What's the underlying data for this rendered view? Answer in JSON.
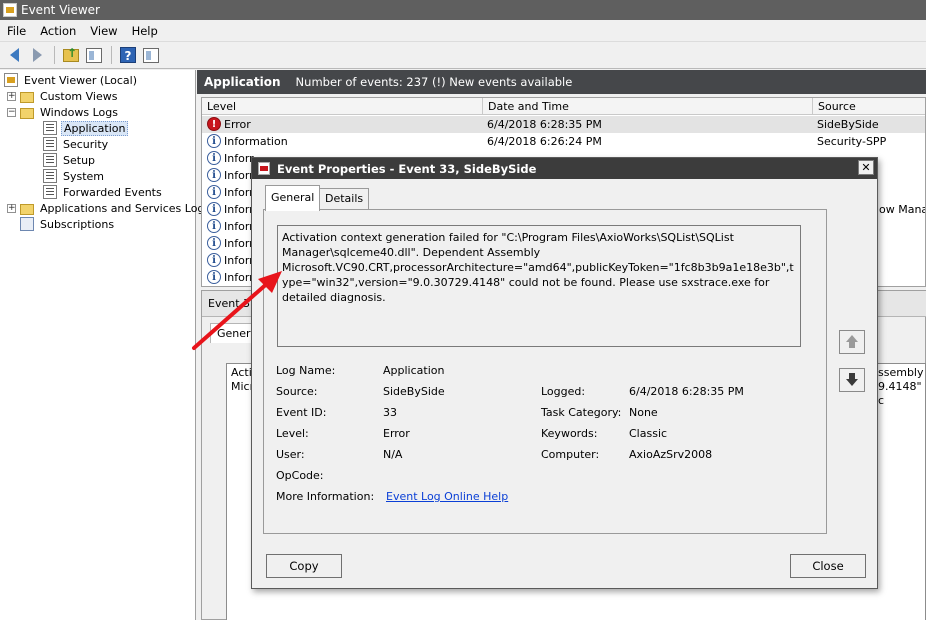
{
  "window": {
    "title": "Event Viewer"
  },
  "menu": [
    "File",
    "Action",
    "View",
    "Help"
  ],
  "toolbar": {
    "icons": [
      "back-arrow-icon",
      "forward-arrow-icon",
      "up-folder-icon",
      "show-hide-pane-icon",
      "help-icon",
      "pane-icon"
    ]
  },
  "tree": {
    "root": "Event Viewer (Local)",
    "custom_views": "Custom Views",
    "windows_logs": "Windows Logs",
    "logs": [
      "Application",
      "Security",
      "Setup",
      "System",
      "Forwarded Events"
    ],
    "apps_services": "Applications and Services Logs",
    "subscriptions": "Subscriptions"
  },
  "header": {
    "title": "Application",
    "summary": "Number of events: 237 (!) New events available"
  },
  "event_list": {
    "columns": [
      "Level",
      "Date and Time",
      "Source"
    ],
    "rows": [
      {
        "level": "Error",
        "datetime": "6/4/2018 6:28:35 PM",
        "source": "SideBySide"
      },
      {
        "level": "Information",
        "datetime": "6/4/2018 6:26:24 PM",
        "source": "Security-SPP"
      },
      {
        "level": "Inforr",
        "datetime": "",
        "source": ""
      },
      {
        "level": "Inforr",
        "datetime": "",
        "source": ""
      },
      {
        "level": "Inforr",
        "datetime": "",
        "source": ""
      },
      {
        "level": "Inforr",
        "datetime": "",
        "source": "ow Mana"
      },
      {
        "level": "Inforr",
        "datetime": "",
        "source": ""
      },
      {
        "level": "Inforr",
        "datetime": "",
        "source": ""
      },
      {
        "level": "Inforr",
        "datetime": "",
        "source": ""
      },
      {
        "level": "Inforr",
        "datetime": "",
        "source": ""
      }
    ]
  },
  "details_pane": {
    "header": "Event 3",
    "tab": "Gener",
    "body_left_1": "Activ",
    "body_left_2": "Micr",
    "body_right_1": "ssembly",
    "body_right_2": "9.4148\" c"
  },
  "dialog": {
    "title": "Event Properties - Event 33, SideBySide",
    "close_label": "✕",
    "tabs": [
      "General",
      "Details"
    ],
    "description": "Activation context generation failed for \"C:\\Program Files\\AxioWorks\\SQList\\SQList Manager\\sqlceme40.dll\". Dependent Assembly Microsoft.VC90.CRT,processorArchitecture=\"amd64\",publicKeyToken=\"1fc8b3b9a1e18e3b\",type=\"win32\",version=\"9.0.30729.4148\" could not be found. Please use sxstrace.exe for detailed diagnosis.",
    "fields": {
      "log_name_label": "Log Name:",
      "log_name": "Application",
      "source_label": "Source:",
      "source": "SideBySide",
      "logged_label": "Logged:",
      "logged": "6/4/2018 6:28:35 PM",
      "event_id_label": "Event ID:",
      "event_id": "33",
      "task_category_label": "Task Category:",
      "task_category": "None",
      "level_label": "Level:",
      "level": "Error",
      "keywords_label": "Keywords:",
      "keywords": "Classic",
      "user_label": "User:",
      "user": "N/A",
      "computer_label": "Computer:",
      "computer": "AxioAzSrv2008",
      "opcode_label": "OpCode:",
      "opcode": "",
      "more_info_label": "More Information:",
      "more_info_link": "Event Log Online Help"
    },
    "buttons": {
      "copy": "Copy",
      "close": "Close"
    }
  },
  "annotation": {
    "arrow_color": "#e8141b"
  }
}
